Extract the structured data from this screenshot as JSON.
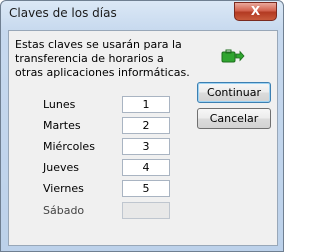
{
  "window": {
    "title": "Claves de los días",
    "close_label": "X"
  },
  "description": "Estas claves se usarán para la transferencia de horarios a otras aplicaciones informáticas.",
  "icon": "suitcase-arrow-icon",
  "days": [
    {
      "label": "Lunes",
      "value": "1"
    },
    {
      "label": "Martes",
      "value": "2"
    },
    {
      "label": "Miércoles",
      "value": "3"
    },
    {
      "label": "Jueves",
      "value": "4"
    },
    {
      "label": "Viernes",
      "value": "5"
    },
    {
      "label": "Sábado",
      "value": ""
    }
  ],
  "buttons": {
    "continue_label": "Continuar",
    "cancel_label": "Cancelar"
  },
  "colors": {
    "icon_green": "#2fa52f",
    "close_red": "#c7432b"
  }
}
